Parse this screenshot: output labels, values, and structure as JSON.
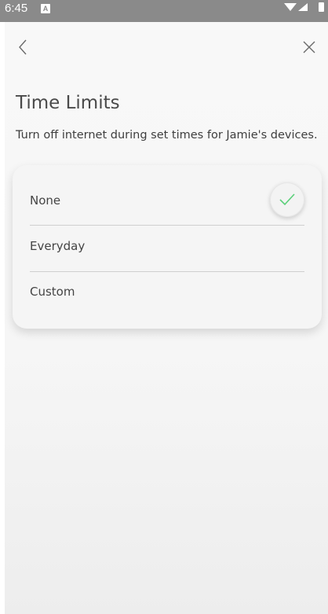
{
  "status_bar": {
    "time": "6:45",
    "icons": [
      "a-notification-icon",
      "wifi-icon",
      "signal-icon",
      "battery-icon"
    ]
  },
  "header": {
    "back_icon": "chevron-left-icon",
    "close_icon": "close-icon"
  },
  "page": {
    "title": "Time Limits",
    "subtitle": "Turn off internet during set times for Jamie's devices."
  },
  "options": [
    {
      "label": "None",
      "selected": true
    },
    {
      "label": "Everyday",
      "selected": false
    },
    {
      "label": "Custom",
      "selected": false
    }
  ],
  "colors": {
    "status_bar": "#8a8a8a",
    "check": "#5bd07a",
    "text": "#3a3a3a"
  }
}
